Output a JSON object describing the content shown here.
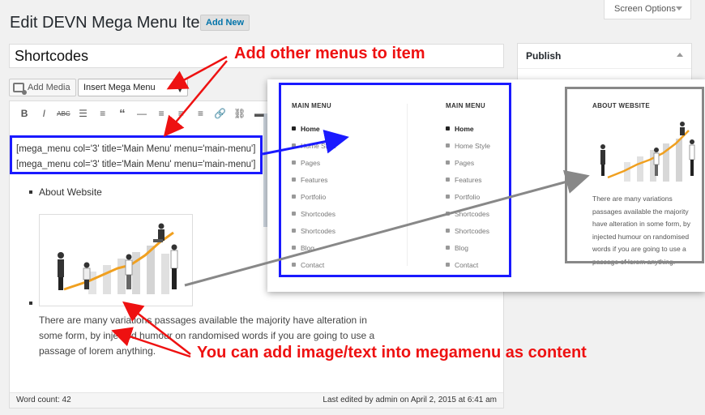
{
  "header": {
    "title": "Edit DEVN Mega Menu Item",
    "add_new": "Add New",
    "screen_options": "Screen Options"
  },
  "post": {
    "title_value": "Shortcodes"
  },
  "media_row": {
    "add_media": "Add Media",
    "insert_select": "Insert Mega Menu"
  },
  "editor": {
    "shortcode_line1": "[mega_menu col='3' title='Main Menu' menu='main-menu']",
    "shortcode_line2": "[mega_menu col='3' title='Main Menu' menu='main-menu']",
    "bullet_label": "About Website",
    "paragraph": "There are many variations passages available the majority have alteration in some form, by injected humour on randomised words if you are going to use a passage of lorem anything.",
    "word_count": "Word count: 42",
    "last_edited": "Last edited by admin on April 2, 2015 at 6:41 am"
  },
  "sidebar": {
    "publish_title": "Publish"
  },
  "preview": {
    "col1": {
      "heading": "MAIN MENU",
      "items": [
        "Home",
        "Home Style",
        "Pages",
        "Features",
        "Portfolio",
        "Shortcodes",
        "Shortcodes",
        "Blog",
        "Contact"
      ]
    },
    "col2": {
      "heading": "MAIN MENU",
      "items": [
        "Home",
        "Home Style",
        "Pages",
        "Features",
        "Portfolio",
        "Shortcodes",
        "Shortcodes",
        "Blog",
        "Contact"
      ]
    },
    "about": {
      "heading": "ABOUT WEBSITE",
      "text": "There are many variations passages available the majority have alteration in some form, by injected humour on randomised words if you are going to use a passage of lorem anything."
    }
  },
  "annotations": {
    "top": "Add other menus to item",
    "bottom": "You can add image/text into megamenu as content"
  },
  "colors": {
    "annotation": "#ee1111",
    "highlight_box": "#1a1aff",
    "about_box": "#888888",
    "link": "#0073aa"
  }
}
